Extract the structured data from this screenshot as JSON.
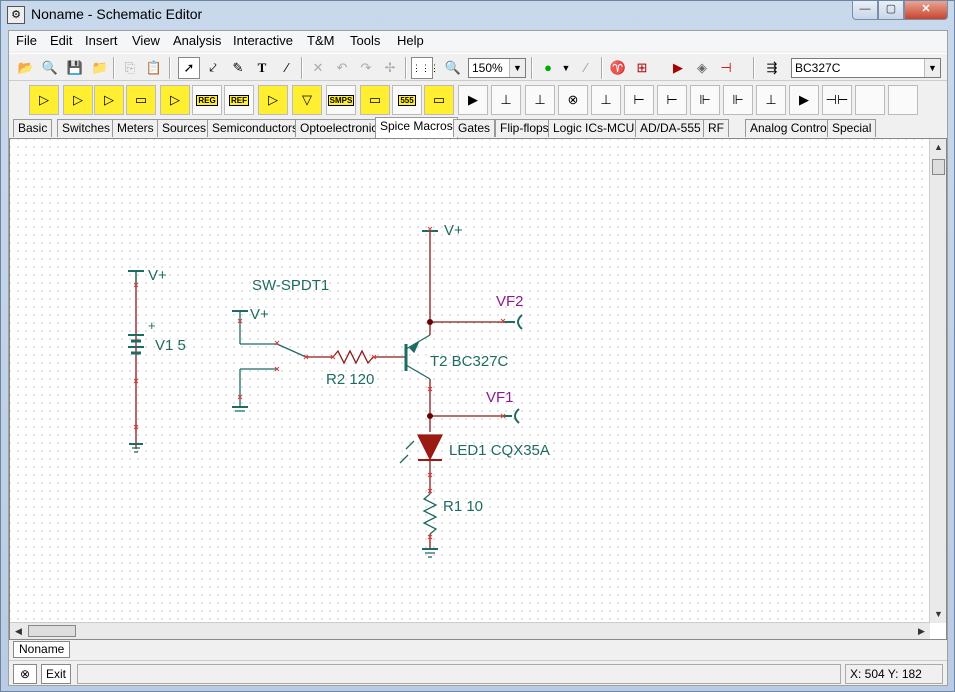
{
  "window": {
    "title": "Noname - Schematic Editor",
    "app_icon": "schematic-app-icon",
    "controls": [
      "minimize",
      "maximize",
      "close"
    ]
  },
  "menu": [
    "File",
    "Edit",
    "Insert",
    "View",
    "Analysis",
    "Interactive",
    "T&M",
    "Tools",
    "Help"
  ],
  "toolbar": {
    "zoom_value": "150%",
    "component_value": "BC327C"
  },
  "component_toolbar_labels": {
    "reg": "REG",
    "ref": "REF",
    "smps": "SMPS",
    "ic555": "555"
  },
  "palette_tabs": [
    "Basic",
    "Switches",
    "Meters",
    "Sources",
    "Semiconductors",
    "Optoelectronic",
    "Spice Macros",
    "Gates",
    "Flip-flops",
    "Logic ICs-MCUs",
    "AD/DA-555",
    "RF",
    "Analog Control",
    "Special"
  ],
  "active_tab": "Spice Macros",
  "schematic": {
    "battery_supply": "V+",
    "battery_plus": "+",
    "battery_label": "V1 5",
    "switch_label": "SW-SPDT1",
    "switch_supply": "V+",
    "resistor_r2": "R2 120",
    "transistor_supply": "V+",
    "transistor_label": "T2 BC327C",
    "probe_vf2": "VF2",
    "probe_vf1": "VF1",
    "led_label": "LED1 CQX35A",
    "resistor_r1": "R1 10"
  },
  "colors": {
    "wire": "#8b1a1a",
    "component": "#1f6b62",
    "probe_label": "#8b1a8b",
    "led_fill": "#9b1a12",
    "node": "#6b0000"
  },
  "sheet_tab": "Noname",
  "status": {
    "exit": "Exit",
    "coords": "X: 504  Y: 182"
  }
}
